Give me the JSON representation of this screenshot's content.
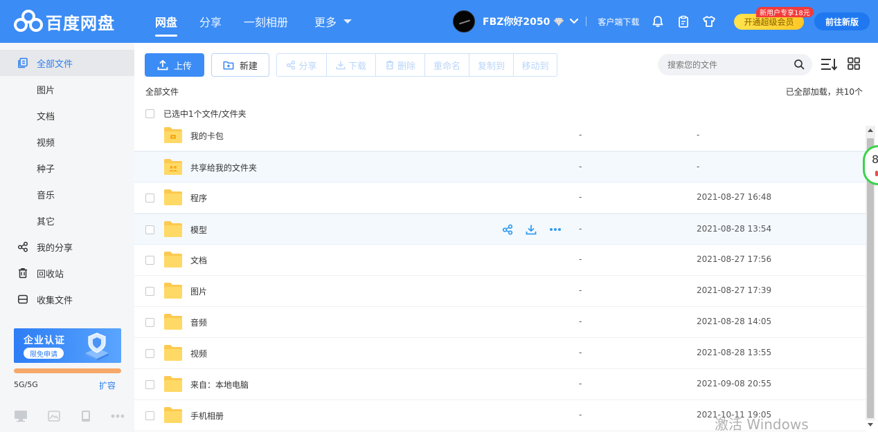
{
  "app": {
    "logo_text": "百度网盘",
    "colors": {
      "brand": "#3b8cf5",
      "accent": "#2e7ef0",
      "folder": "#fdc94f",
      "vip_gold": "#ffd336",
      "badge_red": "#f23b3b",
      "progress_orange": "#f6a86b"
    }
  },
  "topnav": {
    "items": [
      {
        "label": "网盘",
        "active": true
      },
      {
        "label": "分享"
      },
      {
        "label": "一刻相册"
      },
      {
        "label": "更多"
      }
    ]
  },
  "user": {
    "name": "FBZ你好2050",
    "client_download": "客户端下载",
    "vip_button": "开通超级会员",
    "vip_badge": "新用户专享18元",
    "new_version": "前往新版",
    "icons": [
      "bell-icon",
      "clipboard-icon",
      "tshirt-icon",
      "diamond-icon",
      "chevron-down-icon"
    ]
  },
  "sidebar": {
    "items": [
      {
        "label": "全部文件",
        "icon": "files-icon",
        "active": true
      },
      {
        "label": "图片"
      },
      {
        "label": "文档"
      },
      {
        "label": "视频"
      },
      {
        "label": "种子"
      },
      {
        "label": "音乐"
      },
      {
        "label": "其它"
      },
      {
        "label": "我的分享",
        "icon": "share-icon"
      },
      {
        "label": "回收站",
        "icon": "trash-icon"
      },
      {
        "label": "收集文件",
        "icon": "inbox-icon"
      }
    ],
    "banner": {
      "title": "企业认证",
      "button": "限免申请"
    },
    "quota": {
      "text": "5G/5G",
      "used_fraction": 1.0,
      "expand": "扩容"
    },
    "bottom_icons": [
      "desktop-icon",
      "image-icon",
      "phone-icon",
      "more-icon"
    ]
  },
  "toolbar": {
    "upload": "上传",
    "new": "新建",
    "actions": [
      "分享",
      "下载",
      "删除",
      "重命名",
      "复制到",
      "移动到"
    ],
    "search_placeholder": "搜索您的文件"
  },
  "breadcrumb": "全部文件",
  "load_info": "已全部加载，共10个",
  "selection_text": "已选中1个文件/文件夹",
  "files": [
    {
      "name": "我的卡包",
      "size": "-",
      "date": "-",
      "kind": "card-folder"
    },
    {
      "name": "共享给我的文件夹",
      "size": "-",
      "date": "-",
      "kind": "shared-folder"
    },
    {
      "name": "程序",
      "size": "-",
      "date": "2021-08-27 16:48",
      "kind": "folder"
    },
    {
      "name": "模型",
      "size": "-",
      "date": "2021-08-28 13:54",
      "kind": "folder",
      "hover": true
    },
    {
      "name": "文档",
      "size": "-",
      "date": "2021-08-27 17:56",
      "kind": "folder"
    },
    {
      "name": "图片",
      "size": "-",
      "date": "2021-08-27 17:39",
      "kind": "folder"
    },
    {
      "name": "音频",
      "size": "-",
      "date": "2021-08-28 14:05",
      "kind": "folder"
    },
    {
      "name": "视频",
      "size": "-",
      "date": "2021-08-28 13:55",
      "kind": "folder"
    },
    {
      "name": "来自：本地电脑",
      "size": "-",
      "date": "2021-09-08 20:55",
      "kind": "folder"
    },
    {
      "name": "手机相册",
      "size": "-",
      "date": "2021-10-11 19:05",
      "kind": "folder"
    }
  ],
  "float_widget": {
    "number": "8"
  },
  "watermark": "激活 Windows"
}
